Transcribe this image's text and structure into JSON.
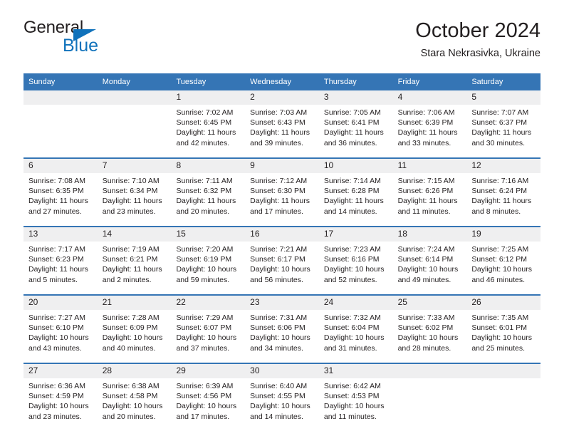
{
  "brand": {
    "name_top": "General",
    "name_bottom": "Blue",
    "color_dark": "#231f20",
    "color_blue": "#1072bb",
    "triangle_icon": "triangle-icon"
  },
  "header": {
    "title": "October 2024",
    "subtitle": "Stara Nekrasivka, Ukraine"
  },
  "theme": {
    "header_blue": "#3575b5",
    "band_gray": "#efeff0",
    "text": "#231f20"
  },
  "calendar": {
    "weekdays": [
      "Sunday",
      "Monday",
      "Tuesday",
      "Wednesday",
      "Thursday",
      "Friday",
      "Saturday"
    ],
    "weeks": [
      [
        {
          "date": "",
          "sunrise": "",
          "sunset": "",
          "daylight": "",
          "daylight2": ""
        },
        {
          "date": "",
          "sunrise": "",
          "sunset": "",
          "daylight": "",
          "daylight2": ""
        },
        {
          "date": "1",
          "sunrise": "Sunrise: 7:02 AM",
          "sunset": "Sunset: 6:45 PM",
          "daylight": "Daylight: 11 hours",
          "daylight2": "and 42 minutes."
        },
        {
          "date": "2",
          "sunrise": "Sunrise: 7:03 AM",
          "sunset": "Sunset: 6:43 PM",
          "daylight": "Daylight: 11 hours",
          "daylight2": "and 39 minutes."
        },
        {
          "date": "3",
          "sunrise": "Sunrise: 7:05 AM",
          "sunset": "Sunset: 6:41 PM",
          "daylight": "Daylight: 11 hours",
          "daylight2": "and 36 minutes."
        },
        {
          "date": "4",
          "sunrise": "Sunrise: 7:06 AM",
          "sunset": "Sunset: 6:39 PM",
          "daylight": "Daylight: 11 hours",
          "daylight2": "and 33 minutes."
        },
        {
          "date": "5",
          "sunrise": "Sunrise: 7:07 AM",
          "sunset": "Sunset: 6:37 PM",
          "daylight": "Daylight: 11 hours",
          "daylight2": "and 30 minutes."
        }
      ],
      [
        {
          "date": "6",
          "sunrise": "Sunrise: 7:08 AM",
          "sunset": "Sunset: 6:35 PM",
          "daylight": "Daylight: 11 hours",
          "daylight2": "and 27 minutes."
        },
        {
          "date": "7",
          "sunrise": "Sunrise: 7:10 AM",
          "sunset": "Sunset: 6:34 PM",
          "daylight": "Daylight: 11 hours",
          "daylight2": "and 23 minutes."
        },
        {
          "date": "8",
          "sunrise": "Sunrise: 7:11 AM",
          "sunset": "Sunset: 6:32 PM",
          "daylight": "Daylight: 11 hours",
          "daylight2": "and 20 minutes."
        },
        {
          "date": "9",
          "sunrise": "Sunrise: 7:12 AM",
          "sunset": "Sunset: 6:30 PM",
          "daylight": "Daylight: 11 hours",
          "daylight2": "and 17 minutes."
        },
        {
          "date": "10",
          "sunrise": "Sunrise: 7:14 AM",
          "sunset": "Sunset: 6:28 PM",
          "daylight": "Daylight: 11 hours",
          "daylight2": "and 14 minutes."
        },
        {
          "date": "11",
          "sunrise": "Sunrise: 7:15 AM",
          "sunset": "Sunset: 6:26 PM",
          "daylight": "Daylight: 11 hours",
          "daylight2": "and 11 minutes."
        },
        {
          "date": "12",
          "sunrise": "Sunrise: 7:16 AM",
          "sunset": "Sunset: 6:24 PM",
          "daylight": "Daylight: 11 hours",
          "daylight2": "and 8 minutes."
        }
      ],
      [
        {
          "date": "13",
          "sunrise": "Sunrise: 7:17 AM",
          "sunset": "Sunset: 6:23 PM",
          "daylight": "Daylight: 11 hours",
          "daylight2": "and 5 minutes."
        },
        {
          "date": "14",
          "sunrise": "Sunrise: 7:19 AM",
          "sunset": "Sunset: 6:21 PM",
          "daylight": "Daylight: 11 hours",
          "daylight2": "and 2 minutes."
        },
        {
          "date": "15",
          "sunrise": "Sunrise: 7:20 AM",
          "sunset": "Sunset: 6:19 PM",
          "daylight": "Daylight: 10 hours",
          "daylight2": "and 59 minutes."
        },
        {
          "date": "16",
          "sunrise": "Sunrise: 7:21 AM",
          "sunset": "Sunset: 6:17 PM",
          "daylight": "Daylight: 10 hours",
          "daylight2": "and 56 minutes."
        },
        {
          "date": "17",
          "sunrise": "Sunrise: 7:23 AM",
          "sunset": "Sunset: 6:16 PM",
          "daylight": "Daylight: 10 hours",
          "daylight2": "and 52 minutes."
        },
        {
          "date": "18",
          "sunrise": "Sunrise: 7:24 AM",
          "sunset": "Sunset: 6:14 PM",
          "daylight": "Daylight: 10 hours",
          "daylight2": "and 49 minutes."
        },
        {
          "date": "19",
          "sunrise": "Sunrise: 7:25 AM",
          "sunset": "Sunset: 6:12 PM",
          "daylight": "Daylight: 10 hours",
          "daylight2": "and 46 minutes."
        }
      ],
      [
        {
          "date": "20",
          "sunrise": "Sunrise: 7:27 AM",
          "sunset": "Sunset: 6:10 PM",
          "daylight": "Daylight: 10 hours",
          "daylight2": "and 43 minutes."
        },
        {
          "date": "21",
          "sunrise": "Sunrise: 7:28 AM",
          "sunset": "Sunset: 6:09 PM",
          "daylight": "Daylight: 10 hours",
          "daylight2": "and 40 minutes."
        },
        {
          "date": "22",
          "sunrise": "Sunrise: 7:29 AM",
          "sunset": "Sunset: 6:07 PM",
          "daylight": "Daylight: 10 hours",
          "daylight2": "and 37 minutes."
        },
        {
          "date": "23",
          "sunrise": "Sunrise: 7:31 AM",
          "sunset": "Sunset: 6:06 PM",
          "daylight": "Daylight: 10 hours",
          "daylight2": "and 34 minutes."
        },
        {
          "date": "24",
          "sunrise": "Sunrise: 7:32 AM",
          "sunset": "Sunset: 6:04 PM",
          "daylight": "Daylight: 10 hours",
          "daylight2": "and 31 minutes."
        },
        {
          "date": "25",
          "sunrise": "Sunrise: 7:33 AM",
          "sunset": "Sunset: 6:02 PM",
          "daylight": "Daylight: 10 hours",
          "daylight2": "and 28 minutes."
        },
        {
          "date": "26",
          "sunrise": "Sunrise: 7:35 AM",
          "sunset": "Sunset: 6:01 PM",
          "daylight": "Daylight: 10 hours",
          "daylight2": "and 25 minutes."
        }
      ],
      [
        {
          "date": "27",
          "sunrise": "Sunrise: 6:36 AM",
          "sunset": "Sunset: 4:59 PM",
          "daylight": "Daylight: 10 hours",
          "daylight2": "and 23 minutes."
        },
        {
          "date": "28",
          "sunrise": "Sunrise: 6:38 AM",
          "sunset": "Sunset: 4:58 PM",
          "daylight": "Daylight: 10 hours",
          "daylight2": "and 20 minutes."
        },
        {
          "date": "29",
          "sunrise": "Sunrise: 6:39 AM",
          "sunset": "Sunset: 4:56 PM",
          "daylight": "Daylight: 10 hours",
          "daylight2": "and 17 minutes."
        },
        {
          "date": "30",
          "sunrise": "Sunrise: 6:40 AM",
          "sunset": "Sunset: 4:55 PM",
          "daylight": "Daylight: 10 hours",
          "daylight2": "and 14 minutes."
        },
        {
          "date": "31",
          "sunrise": "Sunrise: 6:42 AM",
          "sunset": "Sunset: 4:53 PM",
          "daylight": "Daylight: 10 hours",
          "daylight2": "and 11 minutes."
        },
        {
          "date": "",
          "sunrise": "",
          "sunset": "",
          "daylight": "",
          "daylight2": ""
        },
        {
          "date": "",
          "sunrise": "",
          "sunset": "",
          "daylight": "",
          "daylight2": ""
        }
      ]
    ]
  }
}
